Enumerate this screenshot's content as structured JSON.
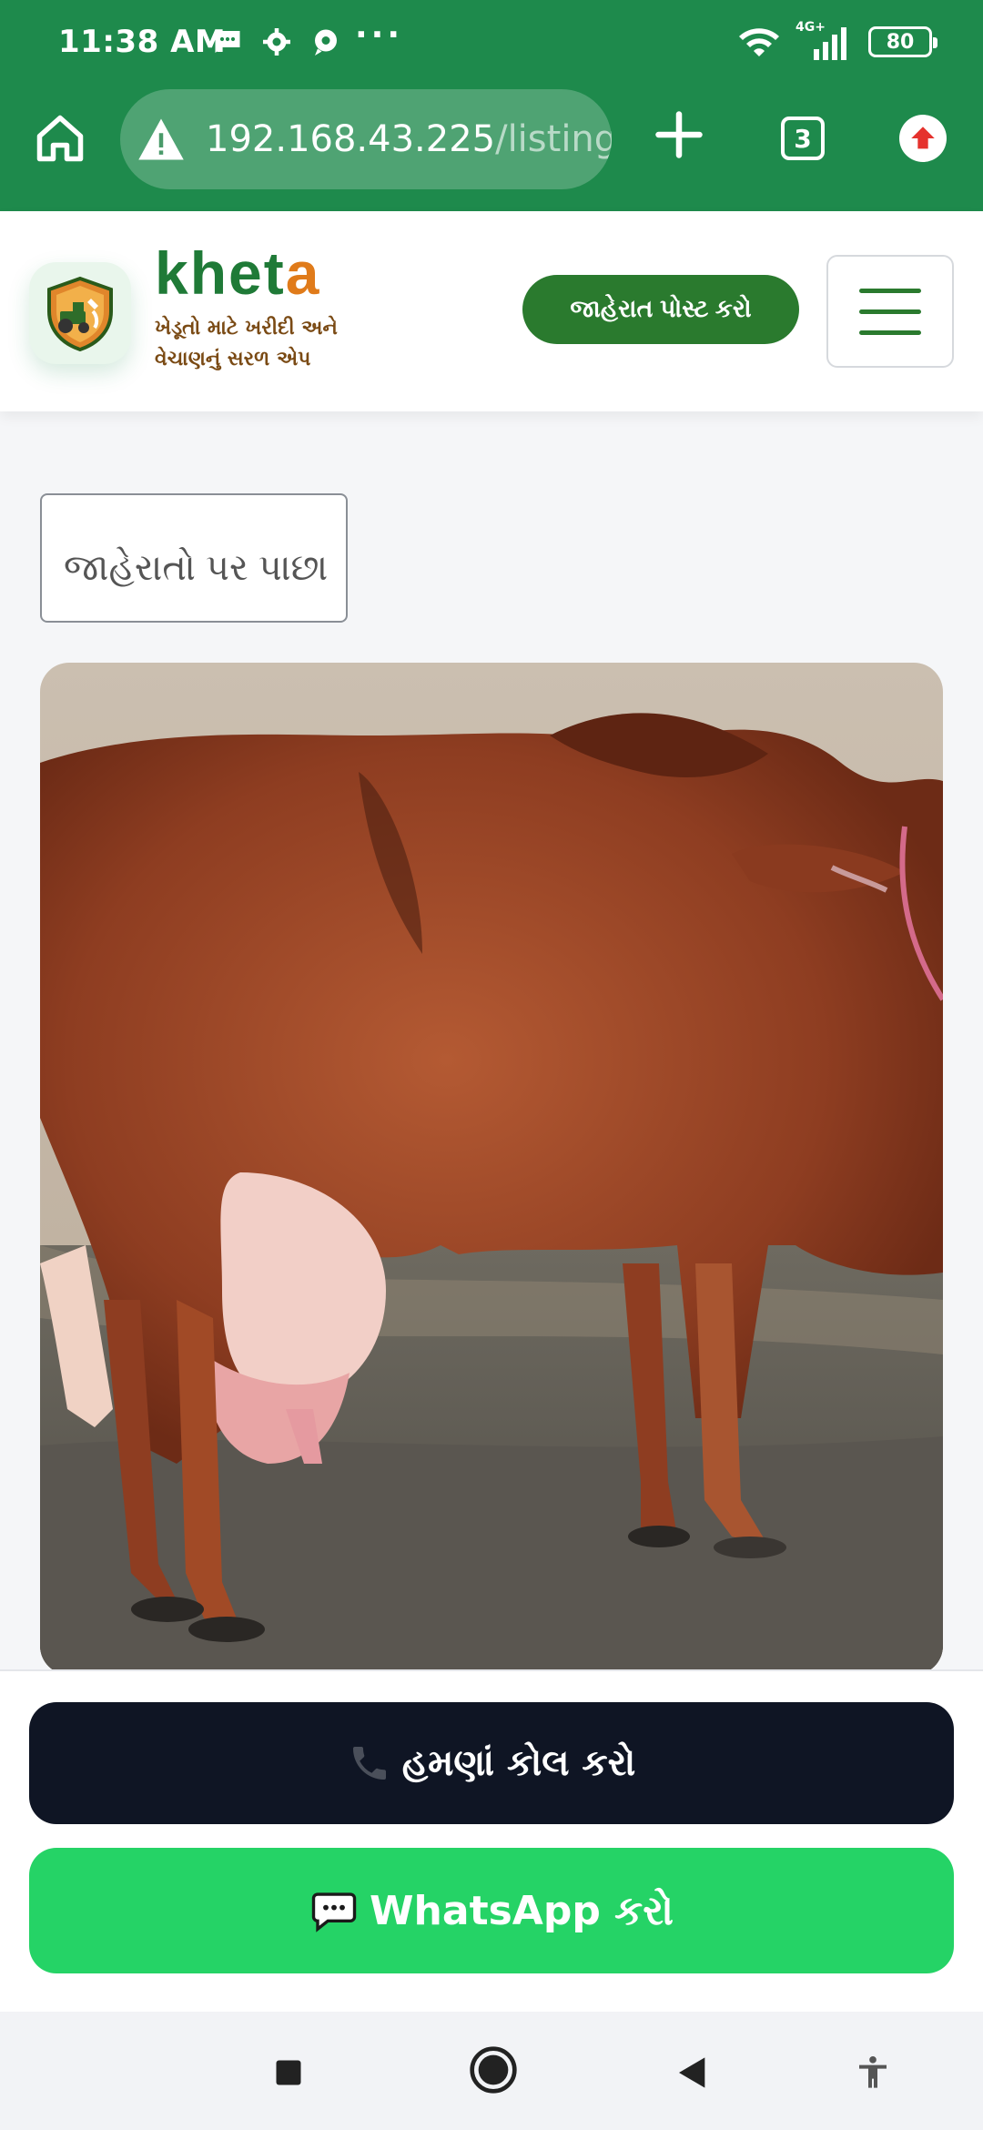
{
  "status_bar": {
    "time": "11:38 AM",
    "more": "···",
    "network": "4G+",
    "battery": "80"
  },
  "browser": {
    "url_host": "192.168.43.225",
    "url_path": "/listing",
    "tab_count": "3"
  },
  "header": {
    "brand_part1": "khet",
    "brand_part2": "a",
    "tagline": "ખેડૂતો માટે ખરીદી અને વેચાણનું સરળ એપ",
    "post_ad_label": "જાહેરાત પોસ્ટ કરો"
  },
  "back_label": "જાહેરાતો પર પાછા",
  "actions": {
    "call_label": "હમણાં કોલ કરો",
    "whatsapp_label": "WhatsApp કરો"
  },
  "colors": {
    "brand_green": "#1e8a4c",
    "header_button": "#2a7a2e",
    "brand_orange": "#e07b1a",
    "call_button": "#0f1524",
    "whatsapp_button": "#25d366"
  },
  "icons": [
    "home-icon",
    "warning-icon",
    "plus-icon",
    "tab-switcher-icon",
    "upgrade-icon",
    "menu-icon",
    "phone-icon",
    "chat-icon",
    "stop-icon",
    "home-circle-icon",
    "back-triangle-icon",
    "accessibility-icon"
  ]
}
